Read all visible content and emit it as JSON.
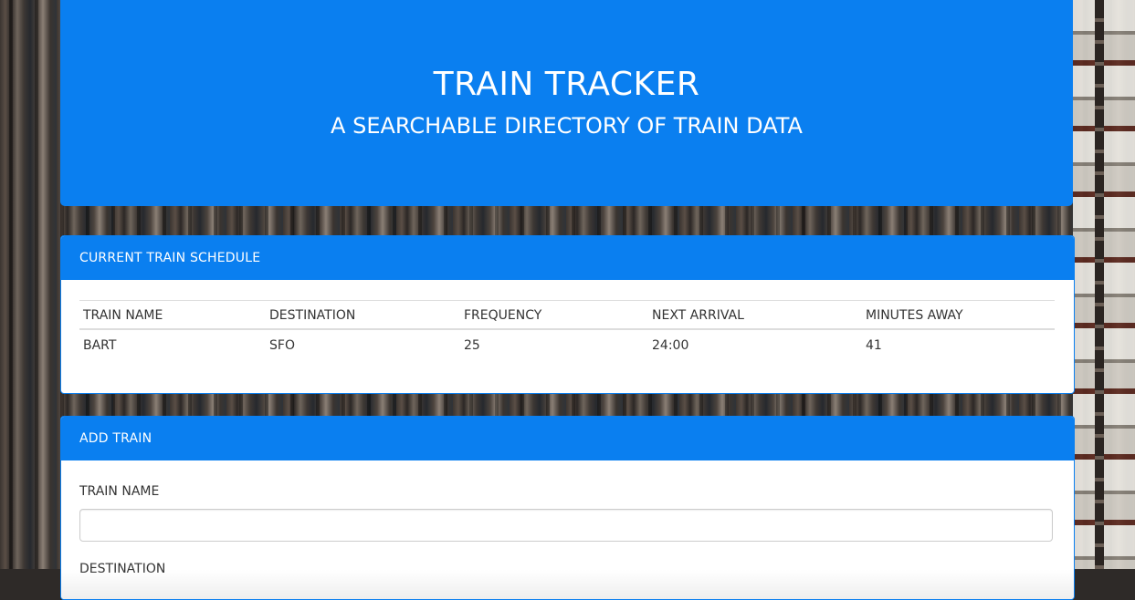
{
  "header": {
    "title": "TRAIN TRACKER",
    "subtitle": "A SEARCHABLE DIRECTORY OF TRAIN DATA"
  },
  "schedule": {
    "heading": "CURRENT TRAIN SCHEDULE",
    "columns": [
      "TRAIN NAME",
      "DESTINATION",
      "FREQUENCY",
      "NEXT ARRIVAL",
      "MINUTES AWAY"
    ],
    "rows": [
      [
        "BART",
        "SFO",
        "25",
        "24:00",
        "41"
      ]
    ]
  },
  "add_train": {
    "heading": "ADD TRAIN",
    "train_name_label": "TRAIN NAME",
    "train_name_value": "",
    "destination_label": "DESTINATION"
  },
  "colors": {
    "accent": "#0a7ff0"
  }
}
